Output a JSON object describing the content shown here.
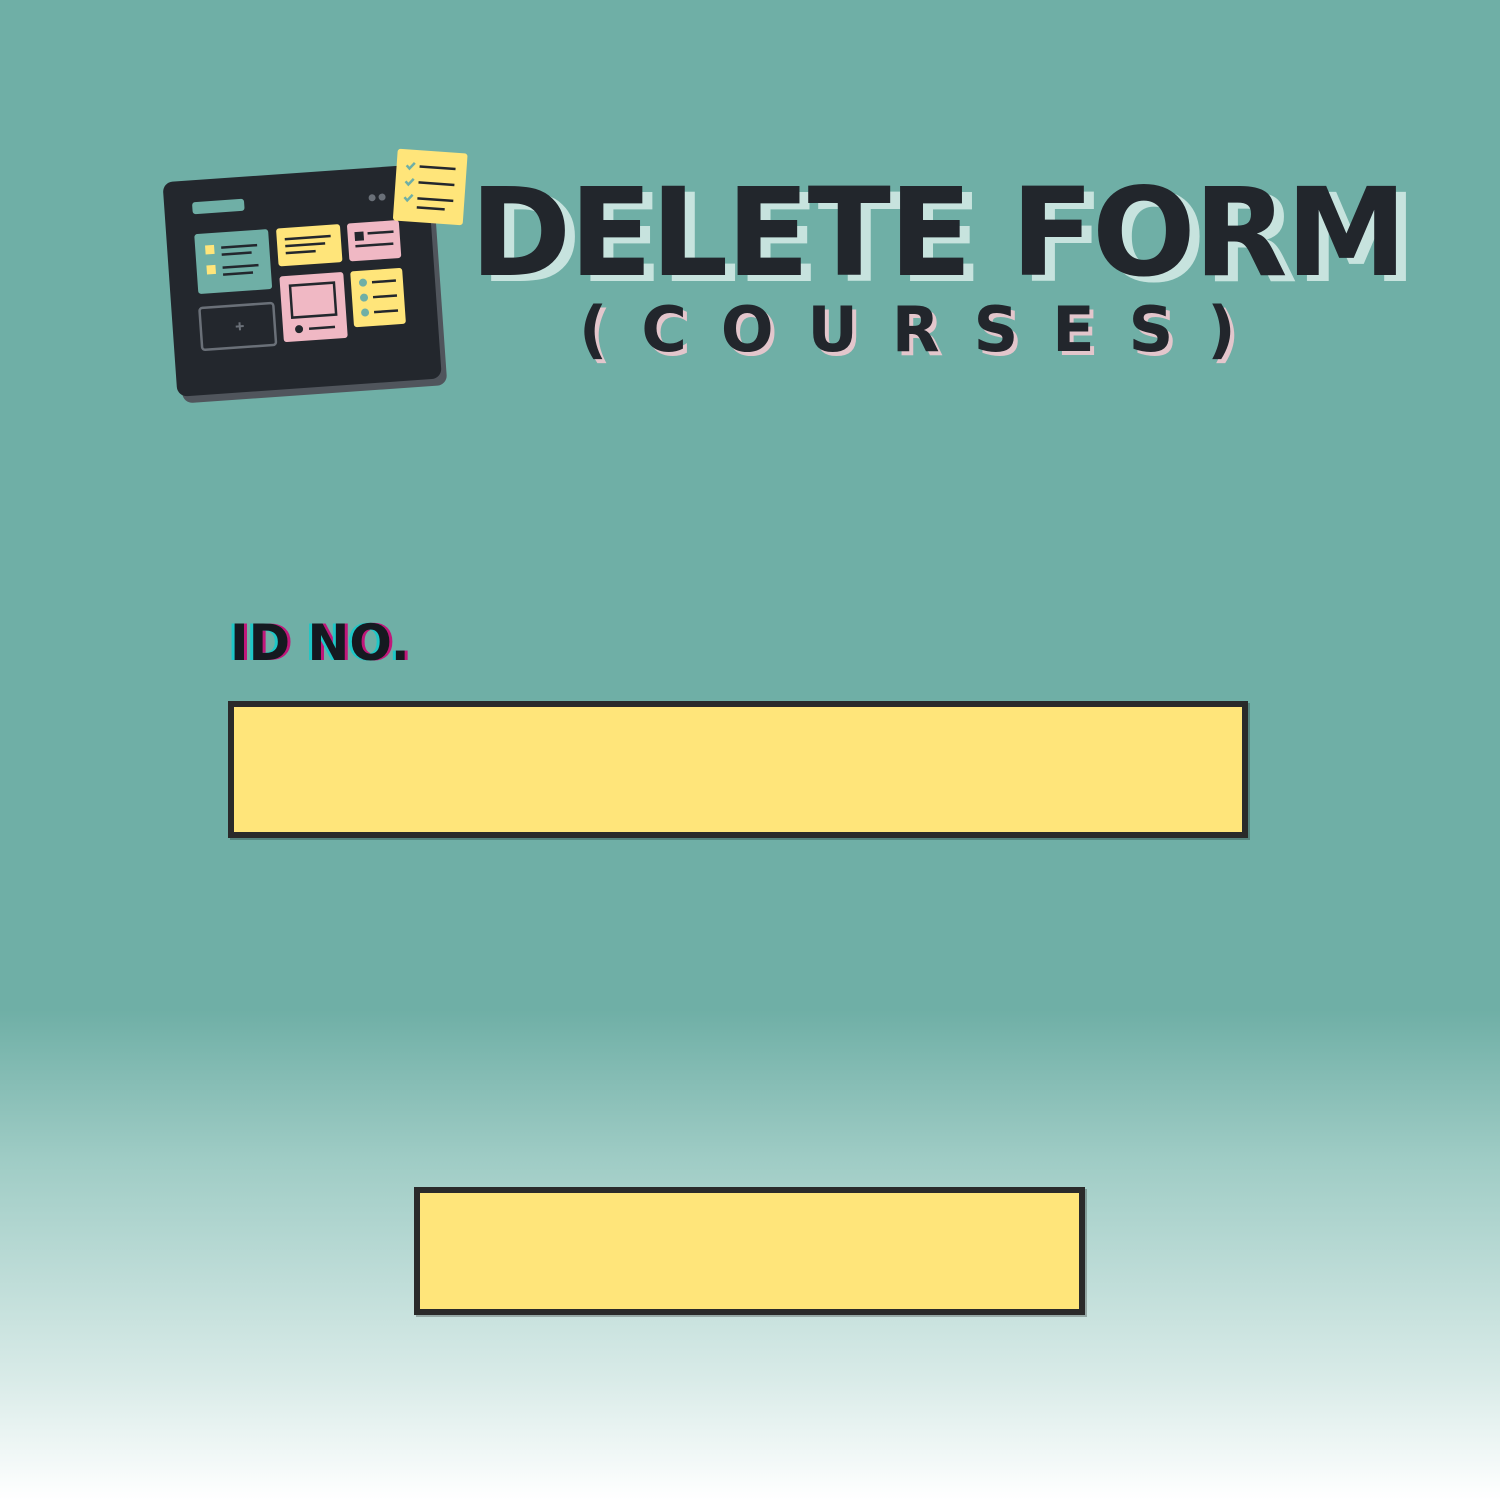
{
  "header": {
    "title": "DELETE FORM",
    "subtitle": "(COURSES)",
    "logo_icon": "kanban-board-icon"
  },
  "form": {
    "id_label": "ID NO.",
    "id_value": "",
    "id_placeholder": "",
    "submit_label": ""
  },
  "colors": {
    "background": "#6fafa6",
    "field_fill": "#ffe57a",
    "field_border": "#2a2a2a",
    "text_dark": "#22262c",
    "title_shadow": "#c7e3de",
    "subtitle_shadow": "#e3c6cc"
  }
}
